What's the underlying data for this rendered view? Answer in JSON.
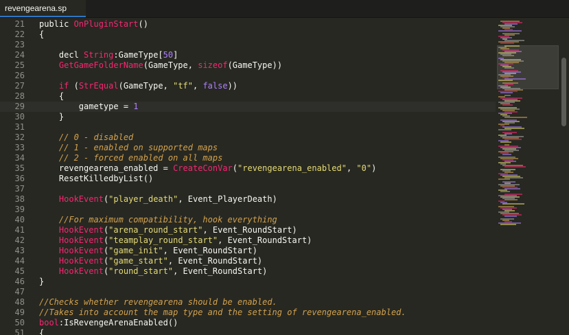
{
  "tab": {
    "title": "revengearena.sp"
  },
  "editor": {
    "current_line": 29,
    "lines": [
      {
        "n": "21",
        "tokens": [
          {
            "t": "public ",
            "c": "tag"
          },
          {
            "t": "OnPluginStart",
            "c": "fn"
          },
          {
            "t": "()",
            "c": "tag"
          }
        ]
      },
      {
        "n": "22",
        "tokens": [
          {
            "t": "{",
            "c": "tag"
          }
        ]
      },
      {
        "n": "23",
        "tokens": []
      },
      {
        "n": "24",
        "tokens": [
          {
            "t": "    decl ",
            "c": "tag"
          },
          {
            "t": "String",
            "c": "fn"
          },
          {
            "t": ":GameType[",
            "c": "tag"
          },
          {
            "t": "50",
            "c": "num"
          },
          {
            "t": "]",
            "c": "tag"
          }
        ]
      },
      {
        "n": "25",
        "tokens": [
          {
            "t": "    ",
            "c": "tag"
          },
          {
            "t": "GetGameFolderName",
            "c": "fn"
          },
          {
            "t": "(GameType, ",
            "c": "tag"
          },
          {
            "t": "sizeof",
            "c": "fn"
          },
          {
            "t": "(GameType))",
            "c": "tag"
          }
        ]
      },
      {
        "n": "26",
        "tokens": []
      },
      {
        "n": "27",
        "tokens": [
          {
            "t": "    ",
            "c": "tag"
          },
          {
            "t": "if",
            "c": "fn"
          },
          {
            "t": " (",
            "c": "tag"
          },
          {
            "t": "StrEqual",
            "c": "fn"
          },
          {
            "t": "(GameType, ",
            "c": "tag"
          },
          {
            "t": "\"tf\"",
            "c": "str"
          },
          {
            "t": ", ",
            "c": "tag"
          },
          {
            "t": "false",
            "c": "num"
          },
          {
            "t": "))",
            "c": "tag"
          }
        ]
      },
      {
        "n": "28",
        "tokens": [
          {
            "t": "    {",
            "c": "tag"
          }
        ]
      },
      {
        "n": "29",
        "tokens": [
          {
            "t": "        gametype = ",
            "c": "tag"
          },
          {
            "t": "1",
            "c": "num"
          }
        ]
      },
      {
        "n": "30",
        "tokens": [
          {
            "t": "    }",
            "c": "tag"
          }
        ]
      },
      {
        "n": "31",
        "tokens": []
      },
      {
        "n": "32",
        "tokens": [
          {
            "t": "    // 0 - disabled",
            "c": "cm"
          }
        ]
      },
      {
        "n": "33",
        "tokens": [
          {
            "t": "    // 1 - enabled on supported maps",
            "c": "cm"
          }
        ]
      },
      {
        "n": "34",
        "tokens": [
          {
            "t": "    // 2 - forced enabled on all maps",
            "c": "cm"
          }
        ]
      },
      {
        "n": "35",
        "tokens": [
          {
            "t": "    revengearena_enabled = ",
            "c": "tag"
          },
          {
            "t": "CreateConVar",
            "c": "fn"
          },
          {
            "t": "(",
            "c": "tag"
          },
          {
            "t": "\"revengearena_enabled\"",
            "c": "str"
          },
          {
            "t": ", ",
            "c": "tag"
          },
          {
            "t": "\"0\"",
            "c": "str"
          },
          {
            "t": ")",
            "c": "tag"
          }
        ]
      },
      {
        "n": "36",
        "tokens": [
          {
            "t": "    ResetKilledbyList()",
            "c": "tag"
          }
        ]
      },
      {
        "n": "37",
        "tokens": []
      },
      {
        "n": "38",
        "tokens": [
          {
            "t": "    ",
            "c": "tag"
          },
          {
            "t": "HookEvent",
            "c": "fn"
          },
          {
            "t": "(",
            "c": "tag"
          },
          {
            "t": "\"player_death\"",
            "c": "str"
          },
          {
            "t": ", Event_PlayerDeath)",
            "c": "tag"
          }
        ]
      },
      {
        "n": "39",
        "tokens": []
      },
      {
        "n": "40",
        "tokens": [
          {
            "t": "    //For maximum compatibility, hook everything",
            "c": "cm"
          }
        ]
      },
      {
        "n": "41",
        "tokens": [
          {
            "t": "    ",
            "c": "tag"
          },
          {
            "t": "HookEvent",
            "c": "fn"
          },
          {
            "t": "(",
            "c": "tag"
          },
          {
            "t": "\"arena_round_start\"",
            "c": "str"
          },
          {
            "t": ", Event_RoundStart)",
            "c": "tag"
          }
        ]
      },
      {
        "n": "42",
        "tokens": [
          {
            "t": "    ",
            "c": "tag"
          },
          {
            "t": "HookEvent",
            "c": "fn"
          },
          {
            "t": "(",
            "c": "tag"
          },
          {
            "t": "\"teamplay_round_start\"",
            "c": "str"
          },
          {
            "t": ", Event_RoundStart)",
            "c": "tag"
          }
        ]
      },
      {
        "n": "43",
        "tokens": [
          {
            "t": "    ",
            "c": "tag"
          },
          {
            "t": "HookEvent",
            "c": "fn"
          },
          {
            "t": "(",
            "c": "tag"
          },
          {
            "t": "\"game_init\"",
            "c": "str"
          },
          {
            "t": ", Event_RoundStart)",
            "c": "tag"
          }
        ]
      },
      {
        "n": "44",
        "tokens": [
          {
            "t": "    ",
            "c": "tag"
          },
          {
            "t": "HookEvent",
            "c": "fn"
          },
          {
            "t": "(",
            "c": "tag"
          },
          {
            "t": "\"game_start\"",
            "c": "str"
          },
          {
            "t": ", Event_RoundStart)",
            "c": "tag"
          }
        ]
      },
      {
        "n": "45",
        "tokens": [
          {
            "t": "    ",
            "c": "tag"
          },
          {
            "t": "HookEvent",
            "c": "fn"
          },
          {
            "t": "(",
            "c": "tag"
          },
          {
            "t": "\"round_start\"",
            "c": "str"
          },
          {
            "t": ", Event_RoundStart)",
            "c": "tag"
          }
        ]
      },
      {
        "n": "46",
        "tokens": [
          {
            "t": "}",
            "c": "tag"
          }
        ]
      },
      {
        "n": "47",
        "tokens": []
      },
      {
        "n": "48",
        "tokens": [
          {
            "t": "//Checks whether revengearena should be enabled.",
            "c": "cm"
          }
        ]
      },
      {
        "n": "49",
        "tokens": [
          {
            "t": "//Takes into account the map type and the setting of revengearena_enabled.",
            "c": "cm"
          }
        ]
      },
      {
        "n": "50",
        "tokens": [
          {
            "t": "bool",
            "c": "fn"
          },
          {
            "t": ":IsRevengeArenaEnabled()",
            "c": "tag"
          }
        ]
      },
      {
        "n": "51",
        "tokens": [
          {
            "t": "{",
            "c": "tag"
          }
        ]
      }
    ]
  },
  "colors": {
    "background": "#272822",
    "plain": "#f8f8f2",
    "function": "#f92672",
    "string": "#e6db74",
    "number": "#ae81ff",
    "comment": "#d4a24c",
    "line_number": "#90908a"
  }
}
